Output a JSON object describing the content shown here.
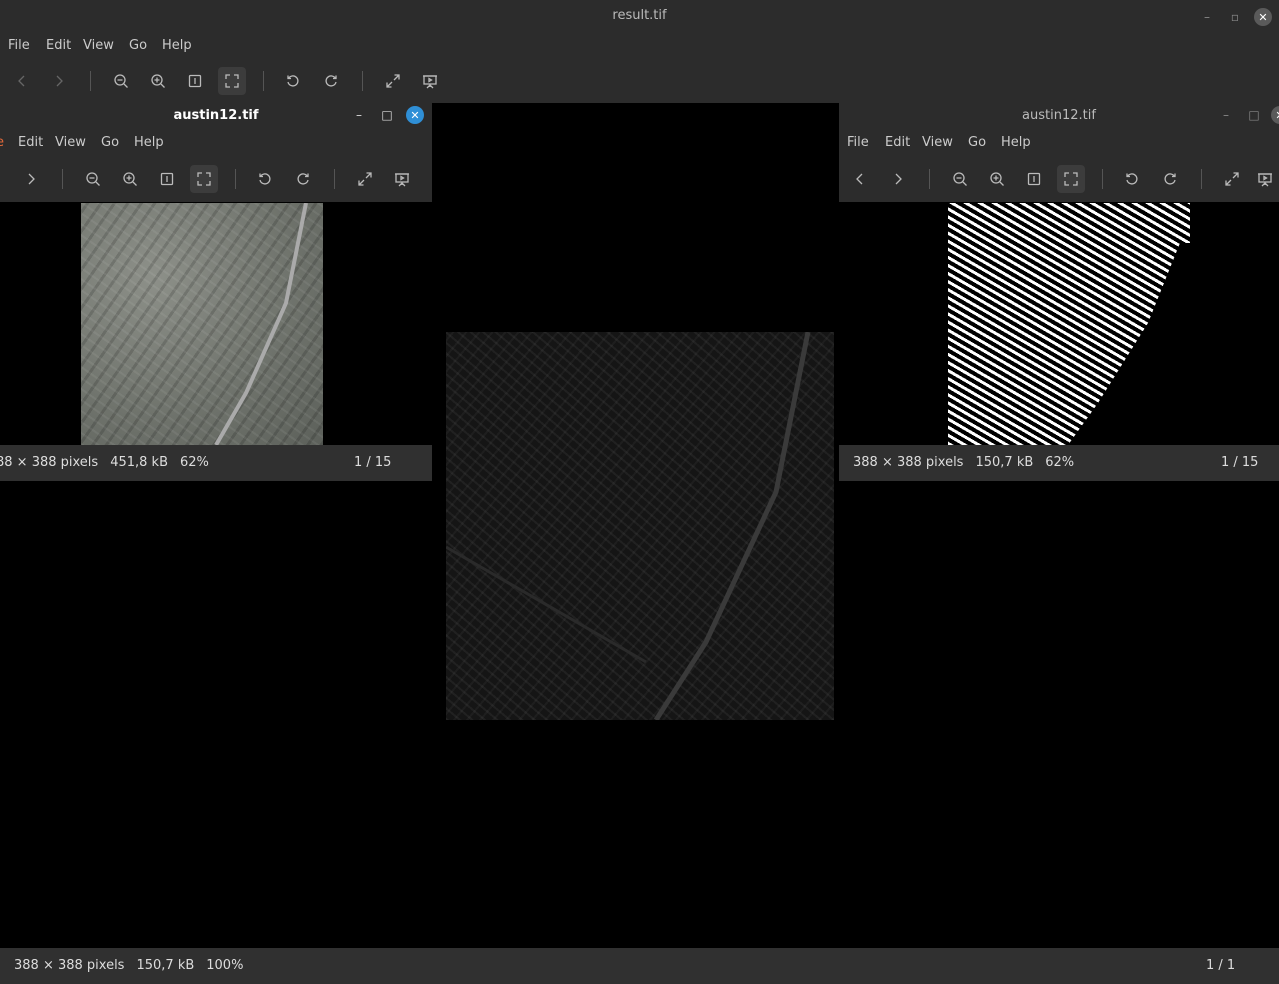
{
  "main_window": {
    "title": "result.tif",
    "menus": [
      "File",
      "Edit",
      "View",
      "Go",
      "Help"
    ],
    "status": {
      "dimensions": "388 × 388 pixels",
      "size": "150,7 kB",
      "zoom": "100%",
      "page": "1 / 1"
    }
  },
  "left_window": {
    "title": "austin12.tif",
    "menus": [
      "Edit",
      "View",
      "Go",
      "Help"
    ],
    "status": {
      "dimensions": "88 × 388 pixels",
      "size": "451,8 kB",
      "zoom": "62%",
      "page": "1 / 15"
    }
  },
  "right_window": {
    "title": "austin12.tif",
    "menus": [
      "File",
      "Edit",
      "View",
      "Go",
      "Help"
    ],
    "status": {
      "dimensions": "388 × 388 pixels",
      "size": "150,7 kB",
      "zoom": "62%",
      "page": "1 / 15"
    }
  },
  "icons": {
    "prev": "chevron-left-icon",
    "next": "chevron-right-icon",
    "zoom_out": "zoom-out-icon",
    "zoom_in": "zoom-in-icon",
    "original_size": "original-size-icon",
    "best_fit": "best-fit-icon",
    "rotate_left": "rotate-left-icon",
    "rotate_right": "rotate-right-icon",
    "fullscreen": "fullscreen-icon",
    "slideshow": "slideshow-icon"
  }
}
